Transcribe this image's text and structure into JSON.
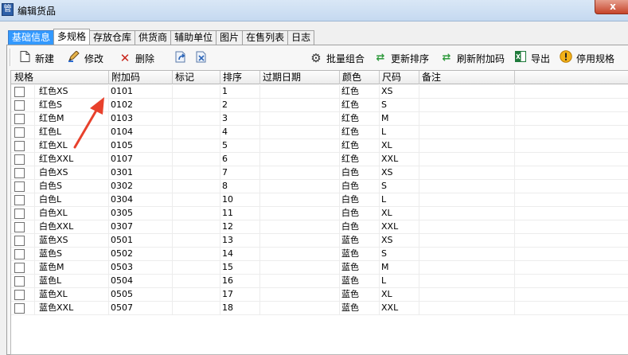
{
  "window": {
    "title": "编辑货品",
    "close_label": "x",
    "app_icon": "管"
  },
  "tabs": [
    "基础信息",
    "多规格",
    "存放仓库",
    "供货商",
    "辅助单位",
    "图片",
    "在售列表",
    "日志"
  ],
  "toolbar": {
    "new": "新建",
    "edit": "修改",
    "delete": "删除",
    "batch": "批量组合",
    "update_sort": "更新排序",
    "refresh_code": "刷新附加码",
    "export": "导出",
    "disable": "停用规格"
  },
  "columns": [
    "规格",
    "附加码",
    "标记",
    "排序",
    "过期日期",
    "颜色",
    "尺码",
    "备注"
  ],
  "rows": [
    {
      "spec": "红色XS",
      "code": "0101",
      "sort": "1",
      "color": "红色",
      "size": "XS"
    },
    {
      "spec": "红色S",
      "code": "0102",
      "sort": "2",
      "color": "红色",
      "size": "S"
    },
    {
      "spec": "红色M",
      "code": "0103",
      "sort": "3",
      "color": "红色",
      "size": "M"
    },
    {
      "spec": "红色L",
      "code": "0104",
      "sort": "4",
      "color": "红色",
      "size": "L"
    },
    {
      "spec": "红色XL",
      "code": "0105",
      "sort": "5",
      "color": "红色",
      "size": "XL"
    },
    {
      "spec": "红色XXL",
      "code": "0107",
      "sort": "6",
      "color": "红色",
      "size": "XXL"
    },
    {
      "spec": "白色XS",
      "code": "0301",
      "sort": "7",
      "color": "白色",
      "size": "XS"
    },
    {
      "spec": "白色S",
      "code": "0302",
      "sort": "8",
      "color": "白色",
      "size": "S"
    },
    {
      "spec": "白色L",
      "code": "0304",
      "sort": "10",
      "color": "白色",
      "size": "L"
    },
    {
      "spec": "白色XL",
      "code": "0305",
      "sort": "11",
      "color": "白色",
      "size": "XL"
    },
    {
      "spec": "白色XXL",
      "code": "0307",
      "sort": "12",
      "color": "白色",
      "size": "XXL"
    },
    {
      "spec": "蓝色XS",
      "code": "0501",
      "sort": "13",
      "color": "蓝色",
      "size": "XS"
    },
    {
      "spec": "蓝色S",
      "code": "0502",
      "sort": "14",
      "color": "蓝色",
      "size": "S"
    },
    {
      "spec": "蓝色M",
      "code": "0503",
      "sort": "15",
      "color": "蓝色",
      "size": "M"
    },
    {
      "spec": "蓝色L",
      "code": "0504",
      "sort": "16",
      "color": "蓝色",
      "size": "L"
    },
    {
      "spec": "蓝色XL",
      "code": "0505",
      "sort": "17",
      "color": "蓝色",
      "size": "XL"
    },
    {
      "spec": "蓝色XXL",
      "code": "0507",
      "sort": "18",
      "color": "蓝色",
      "size": "XXL"
    }
  ],
  "colors": {
    "annotation_arrow": "#e8412c",
    "tab_highlight": "#3399ff"
  }
}
